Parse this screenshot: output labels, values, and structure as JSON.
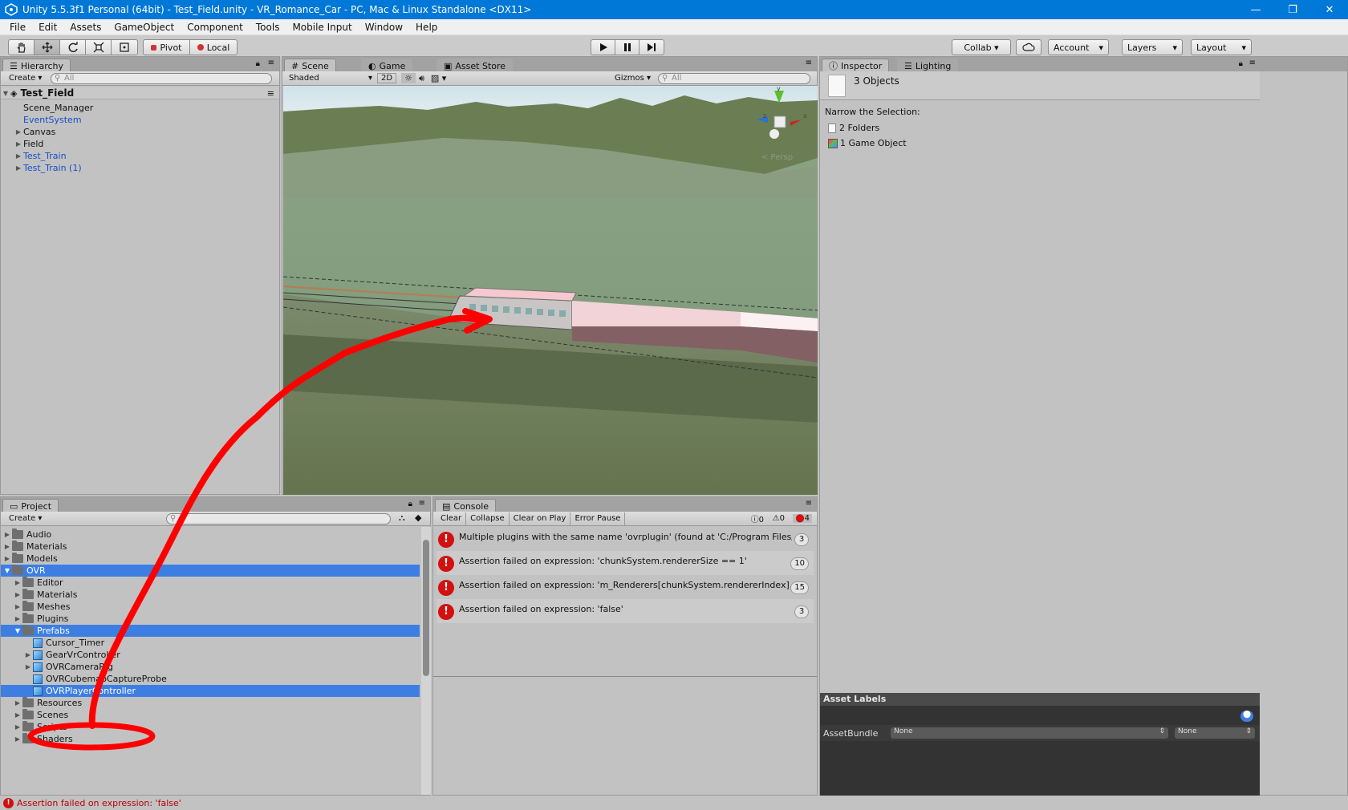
{
  "window": {
    "title": "Unity 5.5.3f1 Personal (64bit) - Test_Field.unity - VR_Romance_Car - PC, Mac & Linux Standalone <DX11>",
    "controls": [
      "—",
      "❐",
      "✕"
    ]
  },
  "menu": [
    "File",
    "Edit",
    "Assets",
    "GameObject",
    "Component",
    "Tools",
    "Mobile Input",
    "Window",
    "Help"
  ],
  "toolbar": {
    "pivot": "Pivot",
    "local": "Local",
    "collab": "Collab ▾",
    "account": "Account",
    "layers": "Layers",
    "layout": "Layout"
  },
  "hierarchy": {
    "tab": "Hierarchy",
    "create": "Create",
    "search_placeholder": "All",
    "scene": "Test_Field",
    "items": [
      {
        "label": "Scene_Manager",
        "expand": "",
        "blue": false
      },
      {
        "label": "EventSystem",
        "expand": "",
        "blue": true
      },
      {
        "label": "Canvas",
        "expand": "▶",
        "blue": false
      },
      {
        "label": "Field",
        "expand": "▶",
        "blue": false
      },
      {
        "label": "Test_Train",
        "expand": "▶",
        "blue": true
      },
      {
        "label": "Test_Train (1)",
        "expand": "▶",
        "blue": true
      }
    ]
  },
  "scene": {
    "tabs": [
      "Scene",
      "Game",
      "Asset Store"
    ],
    "shading": "Shaded",
    "mode2d": "2D",
    "gizmos": "Gizmos",
    "search_placeholder": "All",
    "persp": "< Persp",
    "axis_x": "x",
    "axis_y": "y",
    "axis_z": "z"
  },
  "inspector": {
    "tabs": [
      "Inspector",
      "Lighting"
    ],
    "summary": "3 Objects",
    "narrow": "Narrow the Selection:",
    "selection": [
      "2 Folders",
      "1 Game Object"
    ],
    "asset_labels": "Asset Labels",
    "asset_bundle": "AssetBundle",
    "bundle_value": "None",
    "variant_value": "None"
  },
  "project": {
    "tab": "Project",
    "create": "Create",
    "items": [
      {
        "label": "Audio",
        "expand": "▶",
        "kind": "folder",
        "sel": false,
        "indent": 0
      },
      {
        "label": "Materials",
        "expand": "▶",
        "kind": "folder",
        "sel": false,
        "indent": 0
      },
      {
        "label": "Models",
        "expand": "▶",
        "kind": "folder",
        "sel": false,
        "indent": 0
      },
      {
        "label": "OVR",
        "expand": "▼",
        "kind": "folder",
        "sel": true,
        "indent": 0
      },
      {
        "label": "Editor",
        "expand": "▶",
        "kind": "folder",
        "sel": false,
        "indent": 1
      },
      {
        "label": "Materials",
        "expand": "▶",
        "kind": "folder",
        "sel": false,
        "indent": 1
      },
      {
        "label": "Meshes",
        "expand": "▶",
        "kind": "folder",
        "sel": false,
        "indent": 1
      },
      {
        "label": "Plugins",
        "expand": "▶",
        "kind": "folder",
        "sel": false,
        "indent": 1
      },
      {
        "label": "Prefabs",
        "expand": "▼",
        "kind": "folder",
        "sel": true,
        "indent": 1
      },
      {
        "label": "Cursor_Timer",
        "expand": "",
        "kind": "prefab",
        "sel": false,
        "indent": 2
      },
      {
        "label": "GearVrController",
        "expand": "▶",
        "kind": "prefab",
        "sel": false,
        "indent": 2
      },
      {
        "label": "OVRCameraRig",
        "expand": "▶",
        "kind": "prefab",
        "sel": false,
        "indent": 2
      },
      {
        "label": "OVRCubemapCaptureProbe",
        "expand": "",
        "kind": "prefab",
        "sel": false,
        "indent": 2
      },
      {
        "label": "OVRPlayerController",
        "expand": "",
        "kind": "prefab",
        "sel": true,
        "indent": 2
      },
      {
        "label": "Resources",
        "expand": "▶",
        "kind": "folder",
        "sel": false,
        "indent": 1
      },
      {
        "label": "Scenes",
        "expand": "▶",
        "kind": "folder",
        "sel": false,
        "indent": 1
      },
      {
        "label": "Scripts",
        "expand": "▶",
        "kind": "folder",
        "sel": false,
        "indent": 1
      },
      {
        "label": "Shaders",
        "expand": "▶",
        "kind": "folder",
        "sel": false,
        "indent": 1
      }
    ]
  },
  "console": {
    "tab": "Console",
    "buttons": [
      "Clear",
      "Collapse",
      "Clear on Play",
      "Error Pause"
    ],
    "info_count": "0",
    "warn_count": "0",
    "error_count": "4",
    "entries": [
      {
        "text": "Multiple plugins with the same name 'ovrplugin' (found at 'C:/Program Files/Unity/Ir",
        "count": "3"
      },
      {
        "text": "Assertion failed on expression: 'chunkSystem.rendererSize == 1'",
        "count": "10"
      },
      {
        "text": "Assertion failed on expression: 'm_Renderers[chunkSystem.rendererIndex].re",
        "count": "15"
      },
      {
        "text": "Assertion failed on expression: 'false'",
        "count": "3"
      }
    ]
  },
  "status": {
    "message": "Assertion failed on expression: 'false'"
  },
  "colors": {
    "selection": "#3d7ee3",
    "error": "#d21010",
    "annotation": "#ff0000",
    "titlebar": "#0078d7"
  }
}
